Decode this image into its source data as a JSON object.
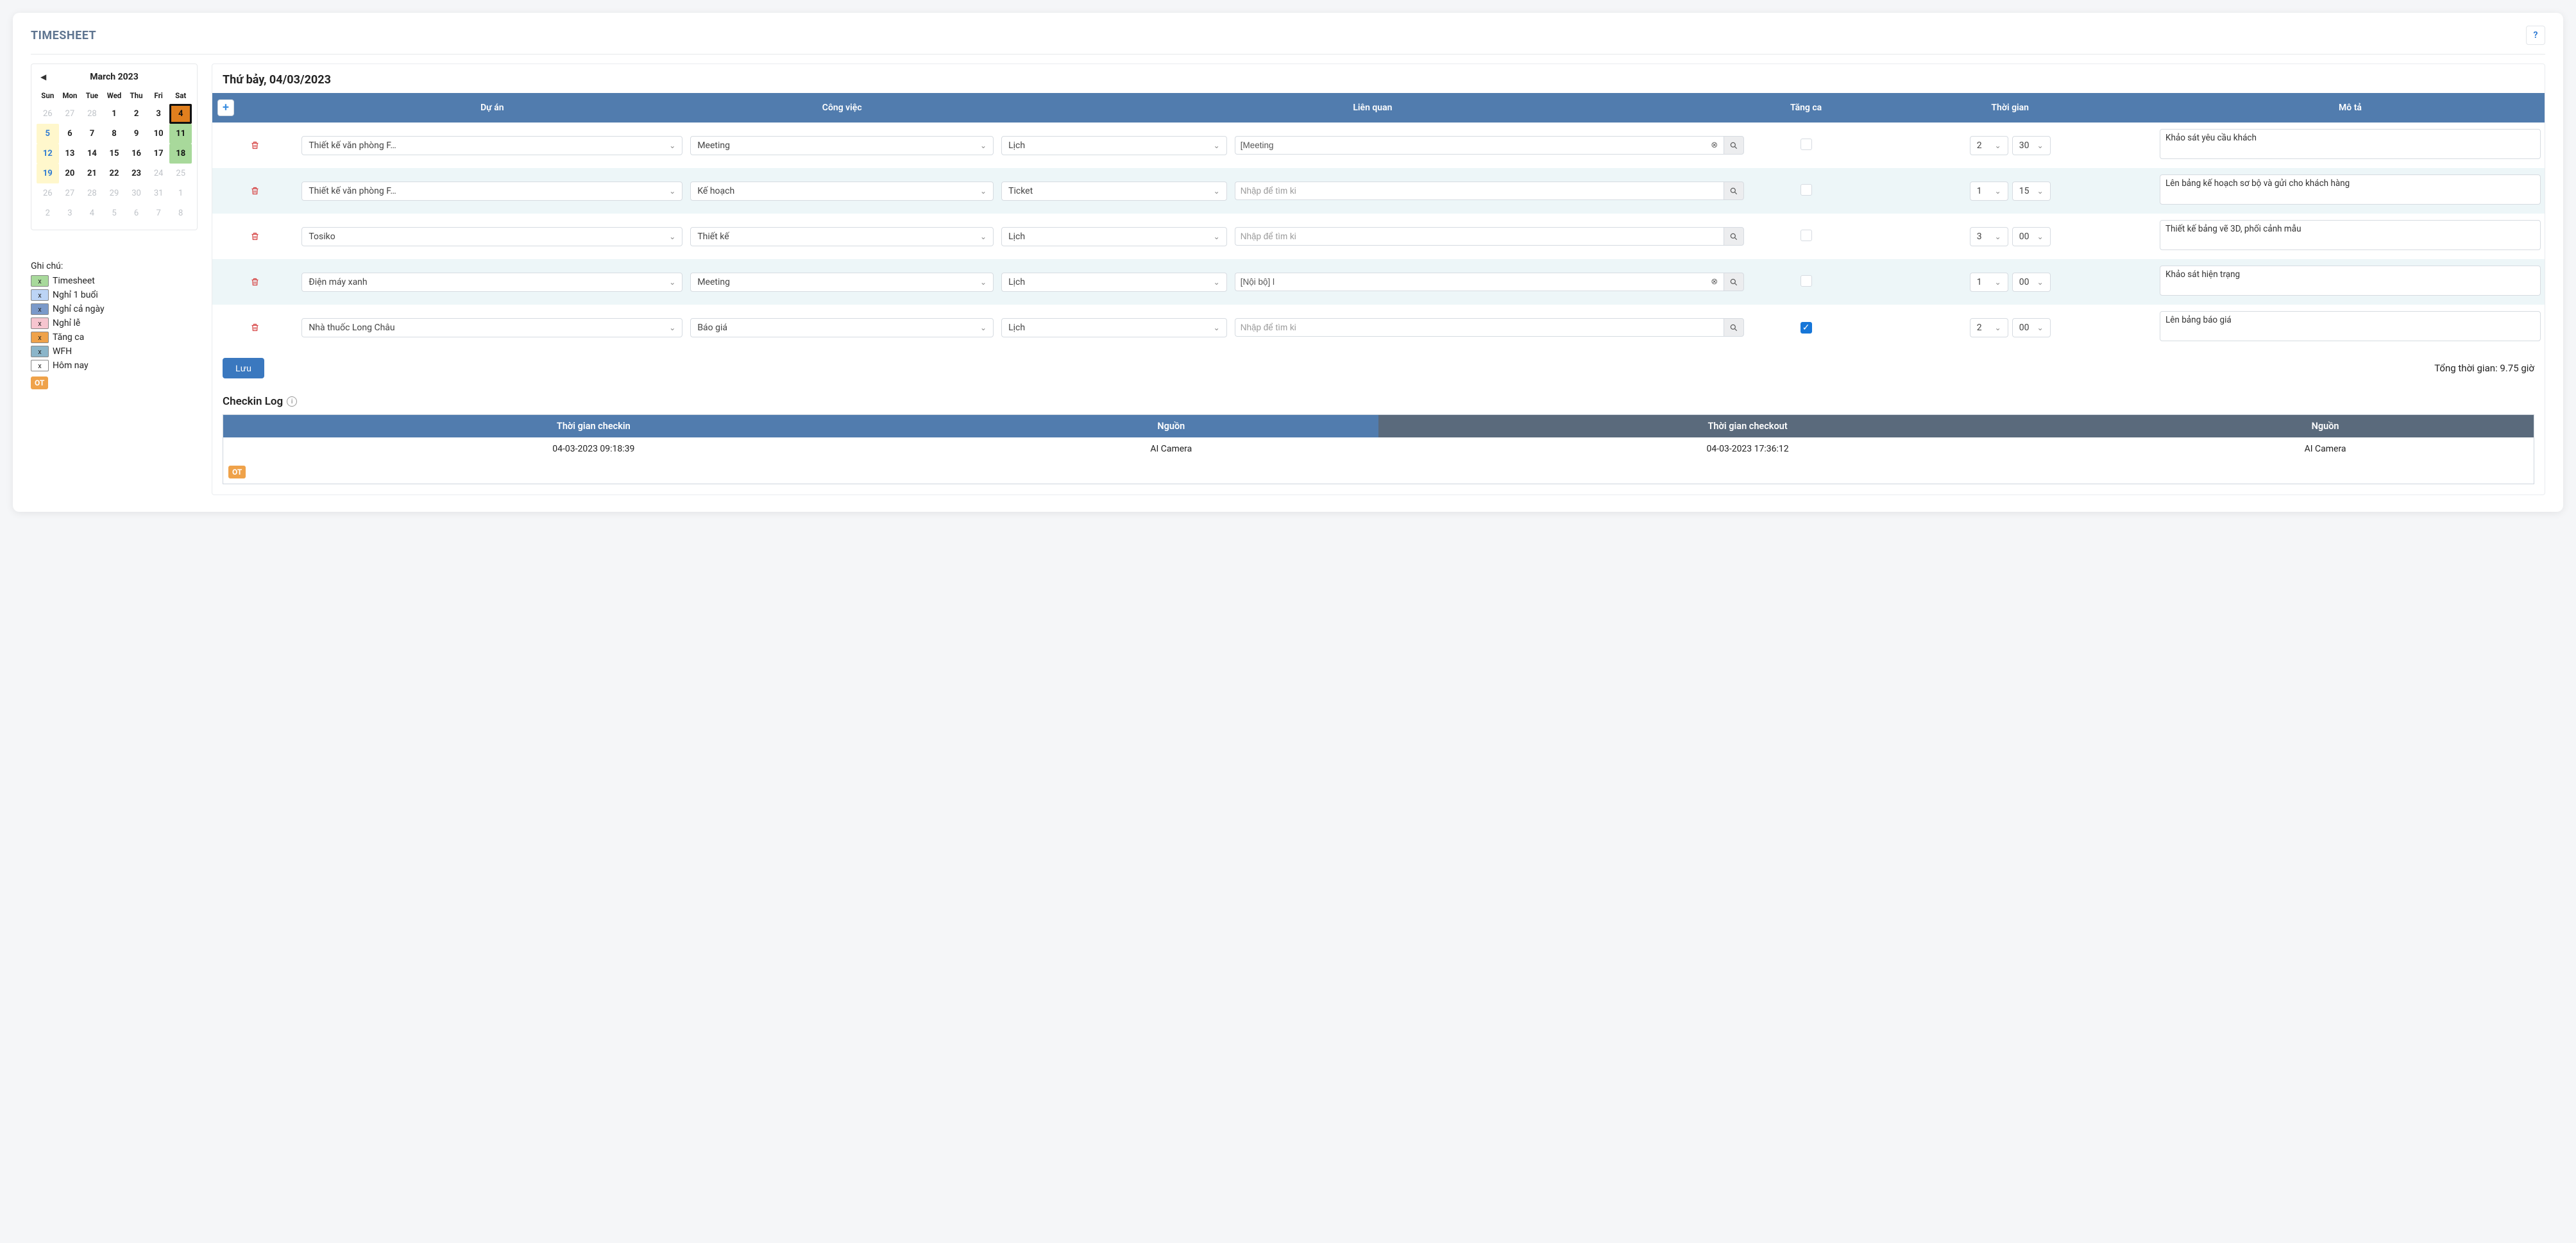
{
  "page": {
    "title": "TIMESHEET"
  },
  "date_heading": "Thứ bảy, 04/03/2023",
  "calendar": {
    "month_label": "March 2023",
    "dow": [
      "Sun",
      "Mon",
      "Tue",
      "Wed",
      "Thu",
      "Fri",
      "Sat"
    ],
    "cells": [
      {
        "n": "26",
        "dim": true
      },
      {
        "n": "27",
        "dim": true
      },
      {
        "n": "28",
        "dim": true
      },
      {
        "n": "1"
      },
      {
        "n": "2"
      },
      {
        "n": "3"
      },
      {
        "n": "4",
        "selected": true
      },
      {
        "n": "5",
        "sun": true
      },
      {
        "n": "6"
      },
      {
        "n": "7"
      },
      {
        "n": "8"
      },
      {
        "n": "9"
      },
      {
        "n": "10"
      },
      {
        "n": "11",
        "green": true
      },
      {
        "n": "12",
        "sun": true
      },
      {
        "n": "13"
      },
      {
        "n": "14"
      },
      {
        "n": "15"
      },
      {
        "n": "16"
      },
      {
        "n": "17"
      },
      {
        "n": "18",
        "green": true
      },
      {
        "n": "19",
        "sun": true
      },
      {
        "n": "20"
      },
      {
        "n": "21"
      },
      {
        "n": "22"
      },
      {
        "n": "23"
      },
      {
        "n": "24",
        "dim": true
      },
      {
        "n": "25",
        "dim": true
      },
      {
        "n": "26",
        "dim": true
      },
      {
        "n": "27",
        "dim": true
      },
      {
        "n": "28",
        "dim": true
      },
      {
        "n": "29",
        "dim": true
      },
      {
        "n": "30",
        "dim": true
      },
      {
        "n": "31",
        "dim": true
      },
      {
        "n": "1",
        "dim": true
      },
      {
        "n": "2",
        "dim": true
      },
      {
        "n": "3",
        "dim": true
      },
      {
        "n": "4",
        "dim": true
      },
      {
        "n": "5",
        "dim": true
      },
      {
        "n": "6",
        "dim": true
      },
      {
        "n": "7",
        "dim": true
      },
      {
        "n": "8",
        "dim": true
      }
    ]
  },
  "legend": {
    "title": "Ghi chú:",
    "items": [
      {
        "label": "Timesheet",
        "color": "lb-green"
      },
      {
        "label": "Nghỉ 1 buổi",
        "color": "lb-blue"
      },
      {
        "label": "Nghỉ cả ngày",
        "color": "lb-dblue"
      },
      {
        "label": "Nghỉ lễ",
        "color": "lb-pink"
      },
      {
        "label": "Tăng ca",
        "color": "lb-orange"
      },
      {
        "label": "WFH",
        "color": "lb-teal"
      },
      {
        "label": "Hôm nay",
        "color": "lb-white"
      }
    ],
    "ot_badge": "OT"
  },
  "table": {
    "headers": {
      "project": "Dự án",
      "task": "Công việc",
      "related": "Liên quan",
      "ot": "Tăng ca",
      "time": "Thời gian",
      "desc": "Mô tả"
    },
    "search_placeholder": "Nhập để tìm ki",
    "rows": [
      {
        "project": "Thiết kế văn phòng F…",
        "task": "Meeting",
        "rel_type": "Lịch",
        "rel_value": "[Meeting",
        "has_clear": true,
        "ot": false,
        "hours": "2",
        "mins": "30",
        "desc": "Khảo sát yêu cầu khách"
      },
      {
        "project": "Thiết kế văn phòng F…",
        "task": "Kế hoạch",
        "rel_type": "Ticket",
        "rel_value": "",
        "has_clear": false,
        "ot": false,
        "hours": "1",
        "mins": "15",
        "desc": "Lên bảng kế hoạch sơ bộ và gửi cho khách hàng"
      },
      {
        "project": "Tosiko",
        "task": "Thiết kế",
        "rel_type": "Lịch",
        "rel_value": "",
        "has_clear": false,
        "ot": false,
        "hours": "3",
        "mins": "00",
        "desc": "Thiết kế bảng vẽ 3D, phối cảnh mẫu"
      },
      {
        "project": "Điện máy xanh",
        "task": "Meeting",
        "rel_type": "Lịch",
        "rel_value": "[Nội bộ] l",
        "has_clear": true,
        "ot": false,
        "hours": "1",
        "mins": "00",
        "desc": "Khảo sát hiện trạng"
      },
      {
        "project": "Nhà thuốc Long Châu",
        "task": "Báo giá",
        "rel_type": "Lịch",
        "rel_value": "",
        "has_clear": false,
        "ot": true,
        "hours": "2",
        "mins": "00",
        "desc": "Lên bảng báo giá"
      }
    ]
  },
  "footer": {
    "save": "Lưu",
    "total": "Tổng thời gian: 9.75 giờ"
  },
  "checkin": {
    "title": "Checkin Log",
    "headers": {
      "in_time": "Thời gian checkin",
      "in_src": "Nguồn",
      "out_time": "Thời gian checkout",
      "out_src": "Nguồn"
    },
    "row": {
      "in_time": "04-03-2023 09:18:39",
      "in_src": "AI Camera",
      "out_time": "04-03-2023 17:36:12",
      "out_src": "AI Camera"
    },
    "ot_badge": "OT"
  }
}
